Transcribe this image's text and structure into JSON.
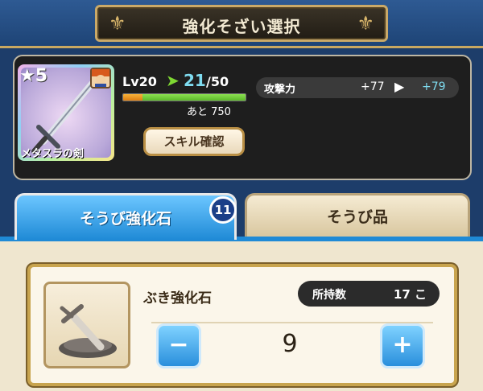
{
  "header": {
    "title": "強化そざい選択"
  },
  "item": {
    "rarity": "5",
    "weapon_name": "メタスラの剣",
    "level_prefix": "Lv20",
    "level_current": "21",
    "level_max": "/50",
    "exp_remaining": "あと 750",
    "exp_progress": 0.16,
    "skill_button": "スキル確認",
    "stat": {
      "label": "攻撃力",
      "before": "+77",
      "after": "+79"
    }
  },
  "tabs": {
    "enhance_label": "そうび強化石",
    "enhance_badge": "11",
    "equipment_label": "そうび品"
  },
  "material": {
    "name": "ぶき強化石",
    "owned_label": "所持数",
    "owned_count": "17 こ",
    "quantity": "9",
    "minus_label": "−",
    "plus_label": "+"
  }
}
